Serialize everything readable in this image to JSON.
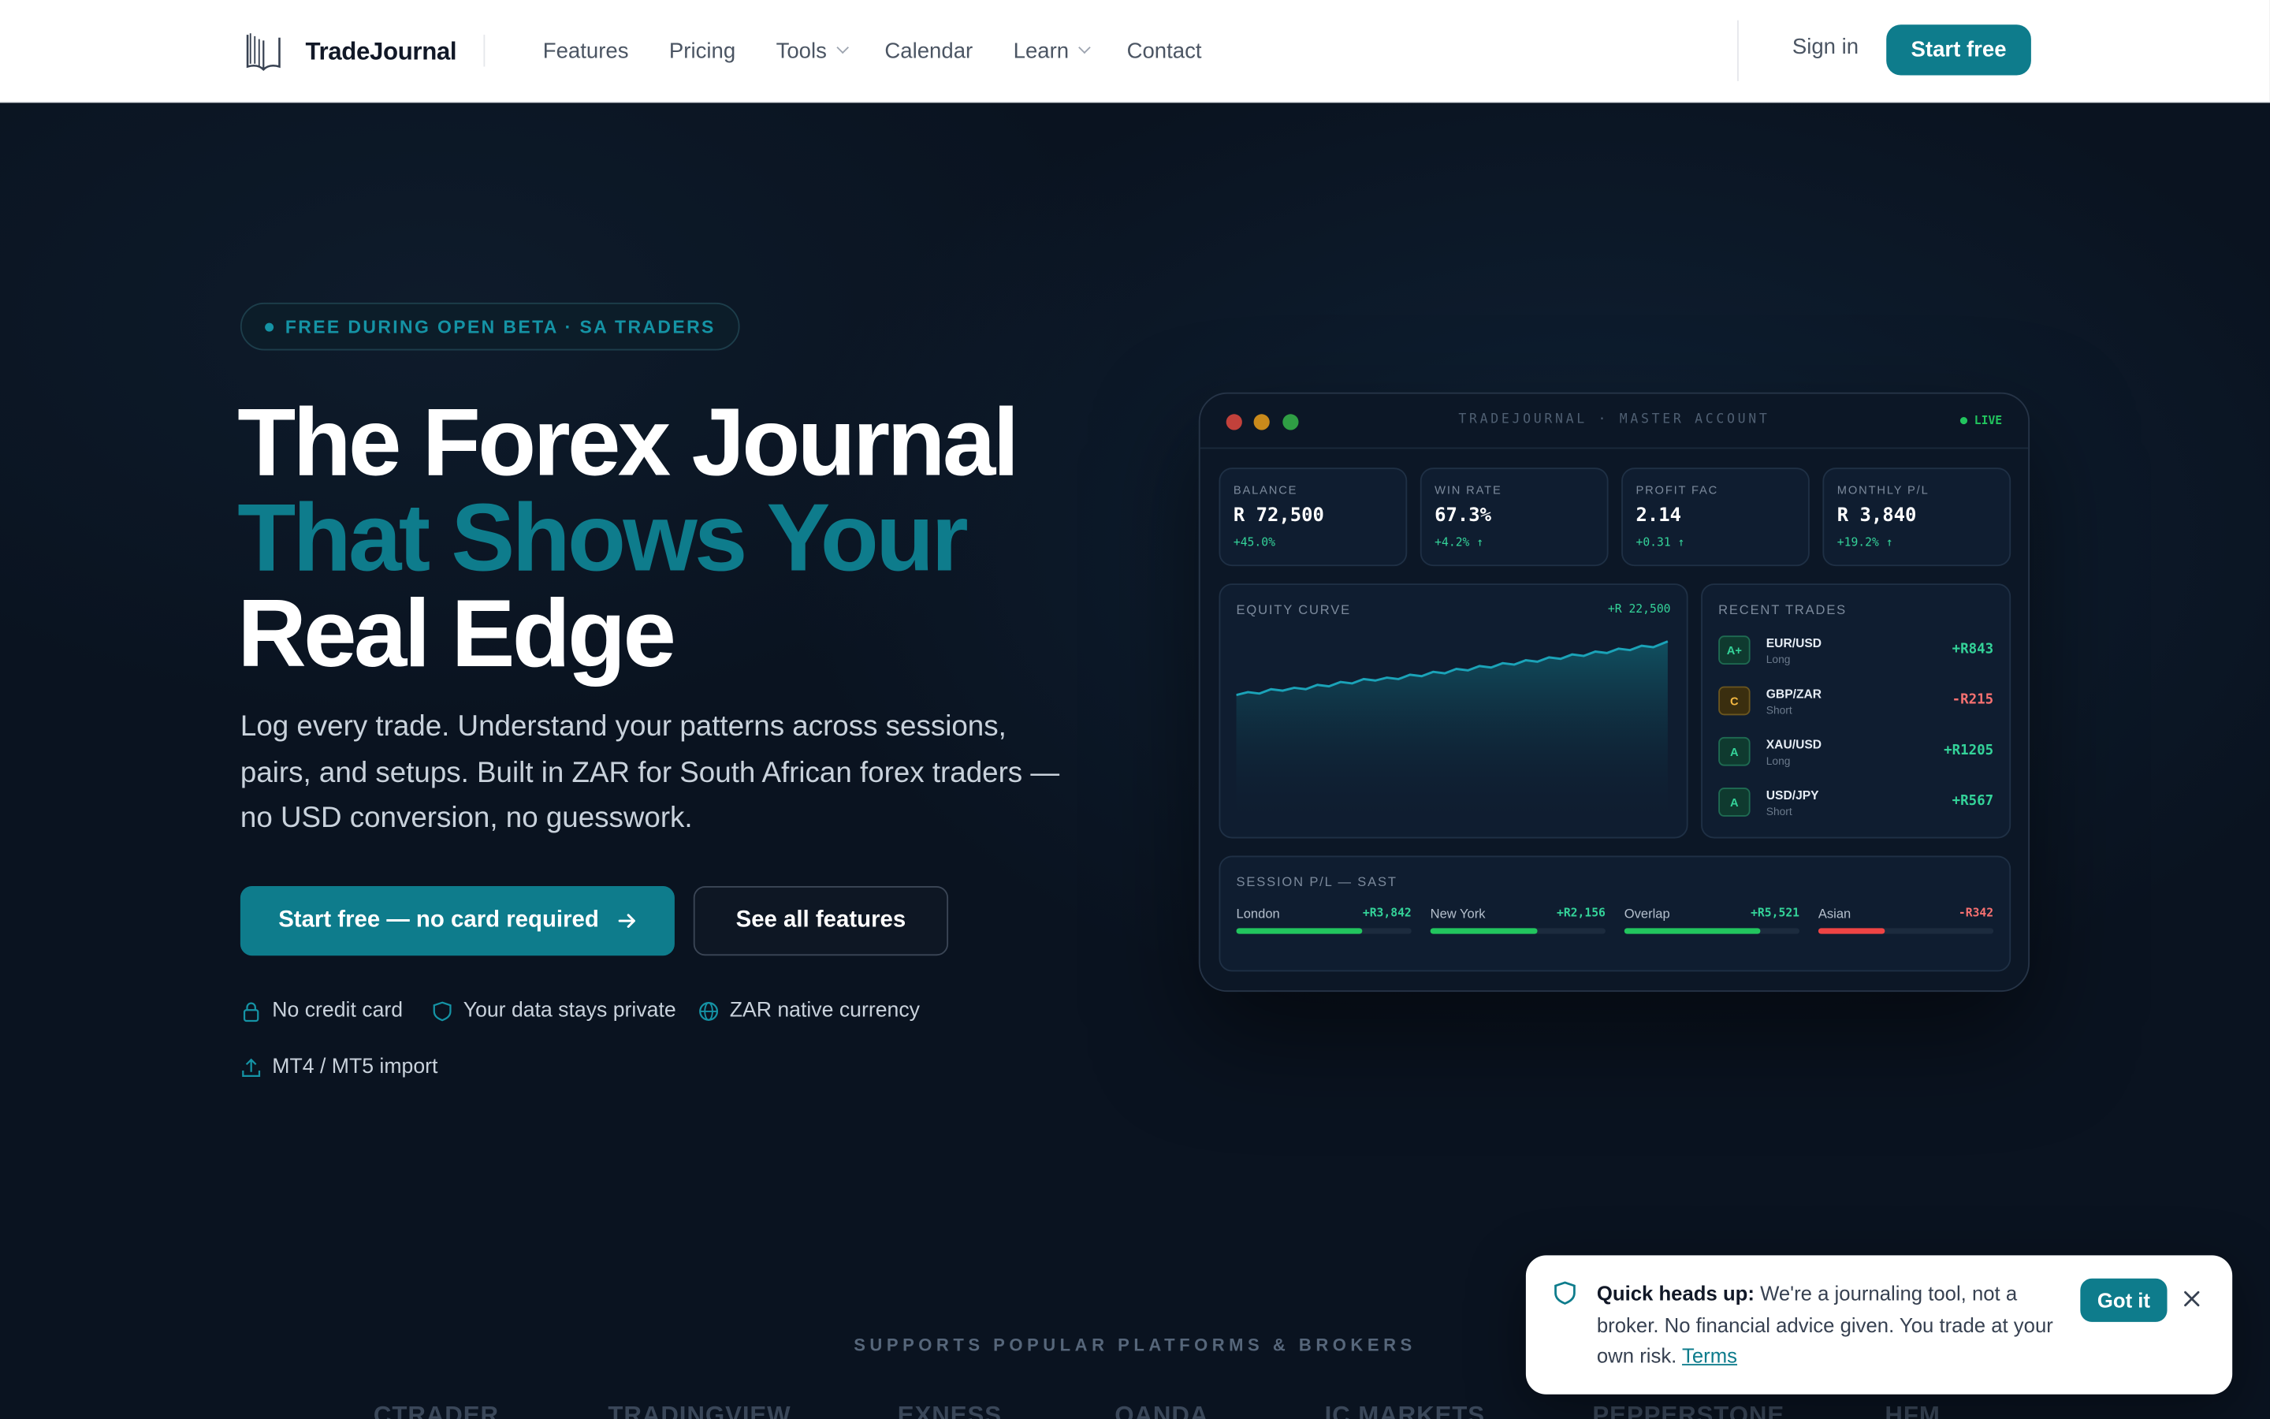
{
  "nav": {
    "brand": "TradeJournal",
    "links": [
      {
        "label": "Features"
      },
      {
        "label": "Pricing"
      },
      {
        "label": "Tools"
      },
      {
        "label": "Calendar"
      },
      {
        "label": "Learn"
      },
      {
        "label": "Contact"
      }
    ],
    "signin": "Sign in",
    "start_free": "Start free"
  },
  "hero": {
    "badge": "FREE DURING OPEN BETA · SA TRADERS",
    "headline_line1": "The Forex Journal",
    "headline_line2": "That Shows Your",
    "headline_line3": "Real Edge",
    "subtitle": "Log every trade. Understand your patterns across sessions, pairs, and setups. Built in ZAR for South African forex traders — no USD conversion, no guesswork.",
    "cta_primary": "Start free — no card required",
    "cta_secondary": "See all features",
    "trust": [
      "No credit card",
      "Your data stays private",
      "ZAR native currency",
      "MT4 / MT5 import"
    ]
  },
  "dashboard": {
    "title": "TRADEJOURNAL · MASTER ACCOUNT",
    "live": "LIVE",
    "stats": [
      {
        "label": "BALANCE",
        "value": "R 72,500",
        "delta": "+45.0%"
      },
      {
        "label": "WIN RATE",
        "value": "67.3%",
        "delta": "+4.2% ↑"
      },
      {
        "label": "PROFIT FAC",
        "value": "2.14",
        "delta": "+0.31 ↑"
      },
      {
        "label": "MONTHLY P/L",
        "value": "R 3,840",
        "delta": "+19.2% ↑"
      }
    ],
    "equity": {
      "label": "EQUITY CURVE",
      "gain": "+R 22,500"
    },
    "recent_label": "RECENT TRADES",
    "trades": [
      {
        "grade": "A+",
        "pair": "EUR/USD",
        "dir": "Long",
        "pnl": "+R843",
        "positive": true
      },
      {
        "grade": "C",
        "pair": "GBP/ZAR",
        "dir": "Short",
        "pnl": "-R215",
        "positive": false
      },
      {
        "grade": "A",
        "pair": "XAU/USD",
        "dir": "Long",
        "pnl": "+R1205",
        "positive": true
      },
      {
        "grade": "A",
        "pair": "USD/JPY",
        "dir": "Short",
        "pnl": "+R567",
        "positive": true
      }
    ],
    "session_label": "SESSION P/L — SAST",
    "sessions": [
      {
        "name": "London",
        "value": "+R3,842",
        "fill": 0.72,
        "positive": true
      },
      {
        "name": "New York",
        "value": "+R2,156",
        "fill": 0.61,
        "positive": true
      },
      {
        "name": "Overlap",
        "value": "+R5,521",
        "fill": 0.78,
        "positive": true
      },
      {
        "name": "Asian",
        "value": "-R342",
        "fill": 0.38,
        "positive": false
      }
    ]
  },
  "platforms": {
    "title": "SUPPORTS POPULAR PLATFORMS & BROKERS",
    "brands": [
      "CTRADER",
      "TRADINGVIEW",
      "EXNESS",
      "OANDA",
      "IC MARKETS",
      "PEPPERSTONE",
      "HFM"
    ]
  },
  "toast": {
    "bold": "Quick heads up:",
    "text": " We're a journaling tool, not a broker. No financial advice given. You trade at your own risk. ",
    "link": "Terms",
    "button": "Got it"
  },
  "colors": {
    "accent": "#0e7c8c",
    "positive": "#34d399",
    "negative": "#f87171",
    "background": "#0a1320"
  }
}
